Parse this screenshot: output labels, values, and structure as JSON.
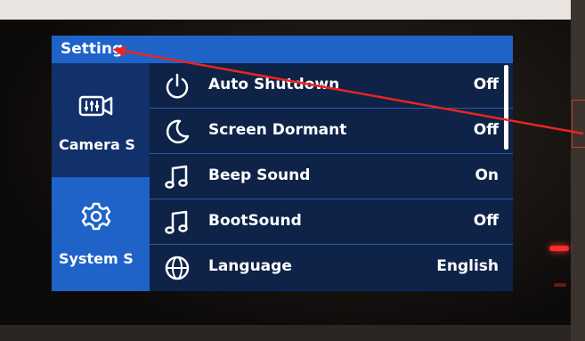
{
  "header": {
    "title": "Setting"
  },
  "sidebar": {
    "items": [
      {
        "label": "Camera S",
        "icon": "camera-settings-icon",
        "active": false
      },
      {
        "label": "System S",
        "icon": "gear-icon",
        "active": true
      }
    ]
  },
  "settings": [
    {
      "label": "Auto Shutdown",
      "value": "Off",
      "icon": "power-icon"
    },
    {
      "label": "Screen Dormant",
      "value": "Off",
      "icon": "moon-icon"
    },
    {
      "label": "Beep Sound",
      "value": "On",
      "icon": "music-note-icon"
    },
    {
      "label": "BootSound",
      "value": "Off",
      "icon": "music-note-icon"
    },
    {
      "label": "Language",
      "value": "English",
      "icon": "globe-icon"
    }
  ],
  "colors": {
    "accent": "#1f63c9",
    "screen_bg": "#0e2347",
    "sidebar_bg": "#12306a",
    "annotation": "#e8261f",
    "led": "#ff2a2a"
  }
}
